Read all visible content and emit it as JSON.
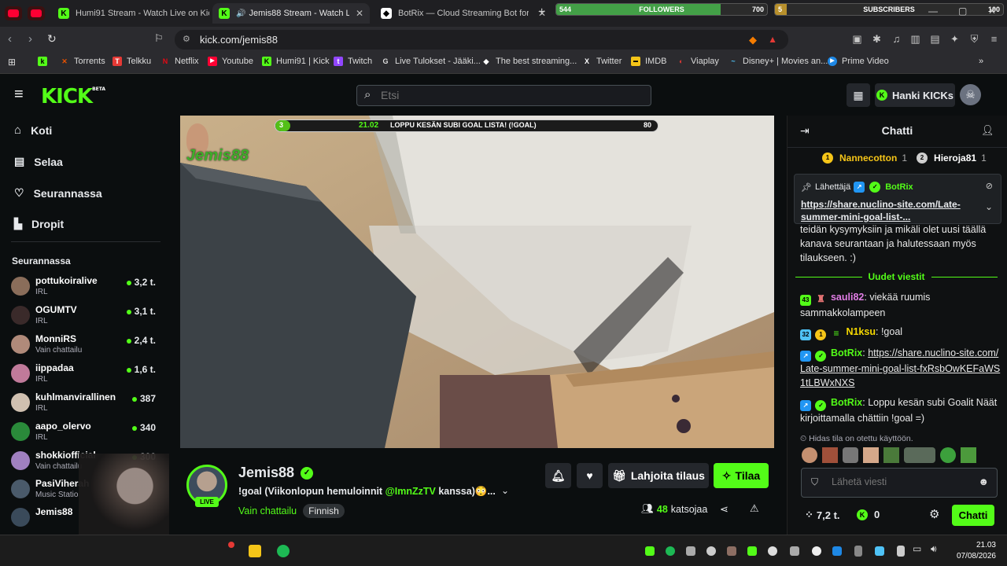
{
  "browser": {
    "tabs": [
      {
        "title": "Humi91 Stream - Watch Live on Kick",
        "active": false
      },
      {
        "title": "Jemis88 Stream - Watch Live on Kick",
        "active": true
      },
      {
        "title": "BotRix — Cloud Streaming Bot for Twitch",
        "active": false
      }
    ],
    "new_tab": "+",
    "followers_goal": {
      "label": "FOLLOWERS",
      "current": "544",
      "target": "700",
      "fraction": 0.78
    },
    "subscribers_goal": {
      "label": "SUBSCRIBERS",
      "current": "5",
      "target": "100",
      "fraction": 0.05
    },
    "url": "kick.com/jemis88",
    "bookmarks": [
      "Torrents",
      "Telkku",
      "Netflix",
      "Youtube",
      "Humi91 | Kick",
      "Twitch",
      "Live Tulokset - Jääki...",
      "The best streaming...",
      "Twitter",
      "IMDB",
      "Viaplay",
      "Disney+ | Movies an...",
      "Prime Video"
    ]
  },
  "header": {
    "logo": "KICK",
    "logo_beta": "BETA",
    "search_placeholder": "Etsi",
    "get_kicks": "Hanki KICKs"
  },
  "sidebar": {
    "nav": [
      {
        "label": "Koti",
        "icon": "home-icon"
      },
      {
        "label": "Selaa",
        "icon": "browse-icon"
      },
      {
        "label": "Seurannassa",
        "icon": "heart-icon"
      },
      {
        "label": "Dropit",
        "icon": "drops-icon"
      }
    ],
    "following_title": "Seurannassa",
    "channels": [
      {
        "name": "pottukoiralive",
        "category": "IRL",
        "viewers": "3,2 t.",
        "color": "#8a6d5a"
      },
      {
        "name": "OGUMTV",
        "category": "IRL",
        "viewers": "3,1 t.",
        "color": "#3a2a2a"
      },
      {
        "name": "MonniRS",
        "category": "Vain chattailu",
        "viewers": "2,4 t.",
        "color": "#b08a7a"
      },
      {
        "name": "iippadaa",
        "category": "IRL",
        "viewers": "1,6 t.",
        "color": "#c07a9a"
      },
      {
        "name": "kuhlmanvirallinen",
        "category": "IRL",
        "viewers": "387",
        "color": "#d0c0b0"
      },
      {
        "name": "aapo_olervo",
        "category": "IRL",
        "viewers": "340",
        "color": "#2a8a3a"
      },
      {
        "name": "shokkiofficial",
        "category": "Vain chattailu",
        "viewers": "300",
        "color": "#a080c0"
      },
      {
        "name": "PasiViherah",
        "category": "Music Statio",
        "viewers": "",
        "color": "#4a5a6a"
      },
      {
        "name": "Jemis88",
        "category": "",
        "viewers": "",
        "color": "#3a4a5a"
      }
    ]
  },
  "overlay": {
    "goal_start": "3",
    "goal_end": "80",
    "goal_time": "21.02",
    "goal_text": "LOPPU KESÄN SUBI GOAL LISTA! (!GOAL)",
    "goal_fraction": 0.02,
    "watermark": "Jemis88"
  },
  "stream": {
    "name": "Jemis88",
    "live": "LIVE",
    "title_pre": "!goal (Viikonlopun hemuloinnit ",
    "title_mention": "@ImnZzTV",
    "title_post": " kanssa)😳...",
    "category": "Vain chattailu",
    "language": "Finnish",
    "gift_label": "Lahjoita tilaus",
    "subscribe_label": "Tilaa",
    "viewers": "48",
    "viewers_label": "katsojaa"
  },
  "chat": {
    "title": "Chatti",
    "top_gifters": [
      {
        "rank": "1",
        "name": "Nannecotton",
        "count": "1"
      },
      {
        "rank": "2",
        "name": "Hieroja81",
        "count": "1"
      }
    ],
    "pinned": {
      "sender_label": "Lähettäjä",
      "sender": "BotRix",
      "link": "https://share.nuclino-site.com/Late-summer-mini-goal-list-..."
    },
    "partial_msg": "teidän kysymyksiin ja mikäli olet uusi täällä kanava seurantaan ja halutessaan myös tilaukseen. :)",
    "new_messages": "Uudet viestit",
    "messages": [
      {
        "badge": "43",
        "user": "sauli82",
        "color": "#e27ee6",
        "text": "viekää ruumis sammakkolampeen",
        "link": ""
      },
      {
        "badge": "32",
        "user": "N1ksu",
        "color": "#f5d800",
        "text": "!goal",
        "link": ""
      },
      {
        "badge": "",
        "user": "BotRix",
        "color": "#53fc18",
        "text": "",
        "link": "https://share.nuclino-site.com/Late-summer-mini-goal-list-fxRsbOwKEFaWS1tLBWxNXS"
      },
      {
        "badge": "",
        "user": "BotRix",
        "color": "#53fc18",
        "text": "Loppu kesän subi Goalit Näät kirjoittamalla chättiin !goal =)",
        "link": ""
      }
    ],
    "slow_mode": "Hidas tila on otettu käyttöön.",
    "input_placeholder": "Lähetä viesti",
    "points": "7,2 t.",
    "kicks": "0",
    "send_label": "Chatti"
  },
  "taskbar": {
    "time": "21.03",
    "date": "07/08/2026"
  }
}
